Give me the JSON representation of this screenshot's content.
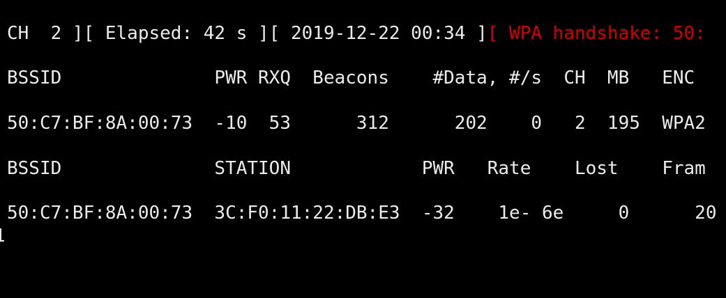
{
  "terminal": {
    "status_line": {
      "channel": "CH  2 ][ Elapsed: 42 s ][ 2019-12-22 00:34 ]",
      "handshake": "[ WPA handshake: 50:"
    },
    "ap_table": {
      "header": "BSSID              PWR RXQ  Beacons    #Data, #/s  CH  MB   ENC",
      "rows": [
        "50:C7:BF:8A:00:73  -10  53      312      202    0   2  195  WPA2"
      ]
    },
    "station_table": {
      "header": "BSSID              STATION            PWR   Rate    Lost    Fram",
      "rows": [
        "50:C7:BF:8A:00:73  3C:F0:11:22:DB:E3  -32    1e- 6e     0      20"
      ],
      "wrap_overflow": "1"
    }
  },
  "colors": {
    "background": "#000000",
    "text": "#ececec",
    "alert": "#d40000"
  }
}
